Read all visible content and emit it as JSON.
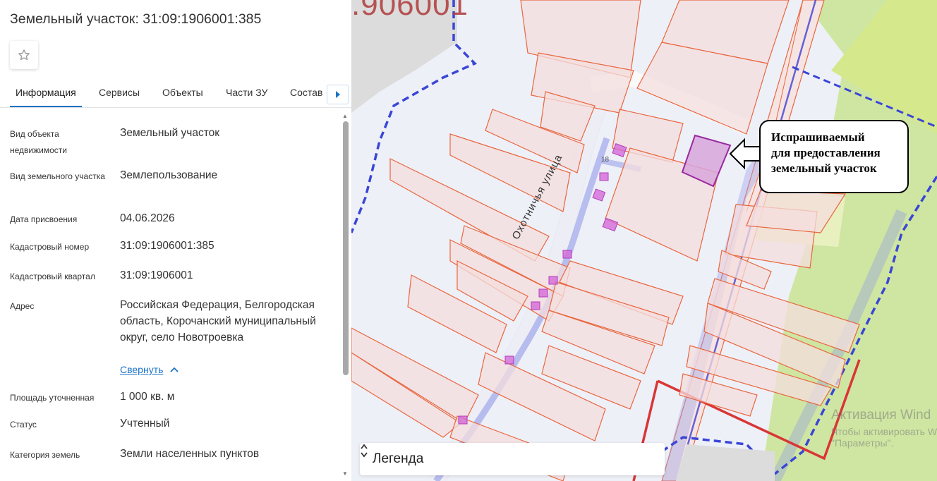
{
  "panel": {
    "title": "Земельный участок: 31:09:1906001:385",
    "tabs": [
      {
        "label": "Информация"
      },
      {
        "label": "Сервисы"
      },
      {
        "label": "Объекты"
      },
      {
        "label": "Части ЗУ"
      },
      {
        "label": "Состав"
      }
    ],
    "rows": [
      {
        "label": "Вид объекта недвижимости",
        "value": "Земельный участок"
      },
      {
        "label": "Вид земельного участка",
        "value": "Землепользование"
      },
      {
        "label": "Дата присвоения",
        "value": "04.06.2026"
      },
      {
        "label": "Кадастровый номер",
        "value": "31:09:1906001:385"
      },
      {
        "label": "Кадастровый квартал",
        "value": "31:09:1906001"
      },
      {
        "label": "Адрес",
        "value": "Российская Федерация, Белгородская область, Корочанский муниципальный округ, село Новотроевка"
      },
      {
        "label": "Площадь уточненная",
        "value": "1 000 кв. м"
      },
      {
        "label": "Статус",
        "value": "Учтенный"
      },
      {
        "label": "Категория земель",
        "value": "Земли населенных пунктов"
      }
    ],
    "collapse_label": "Свернуть"
  },
  "map": {
    "quarter_label": ".906001",
    "street_label": "Охотничья улица",
    "house_number": "18",
    "callout_lines": [
      "Испрашиваемый",
      "для предоставления",
      "земельный участок"
    ],
    "legend_label": "Легенда",
    "watermark": {
      "line1": "Активация Wind",
      "line2": "Чтобы активировать W",
      "line3": "\"Параметры\"."
    }
  },
  "colors": {
    "accent": "#1a73c9",
    "parcel_stroke": "#e8673f",
    "parcel_fill": "#f4dede",
    "selected_parcel_fill": "#d7a6dc",
    "selected_parcel_stroke": "#9a2aa0",
    "boundary_blue": "#3a46d6",
    "boundary_red": "#d93636",
    "green_area": "#c8e39a"
  }
}
